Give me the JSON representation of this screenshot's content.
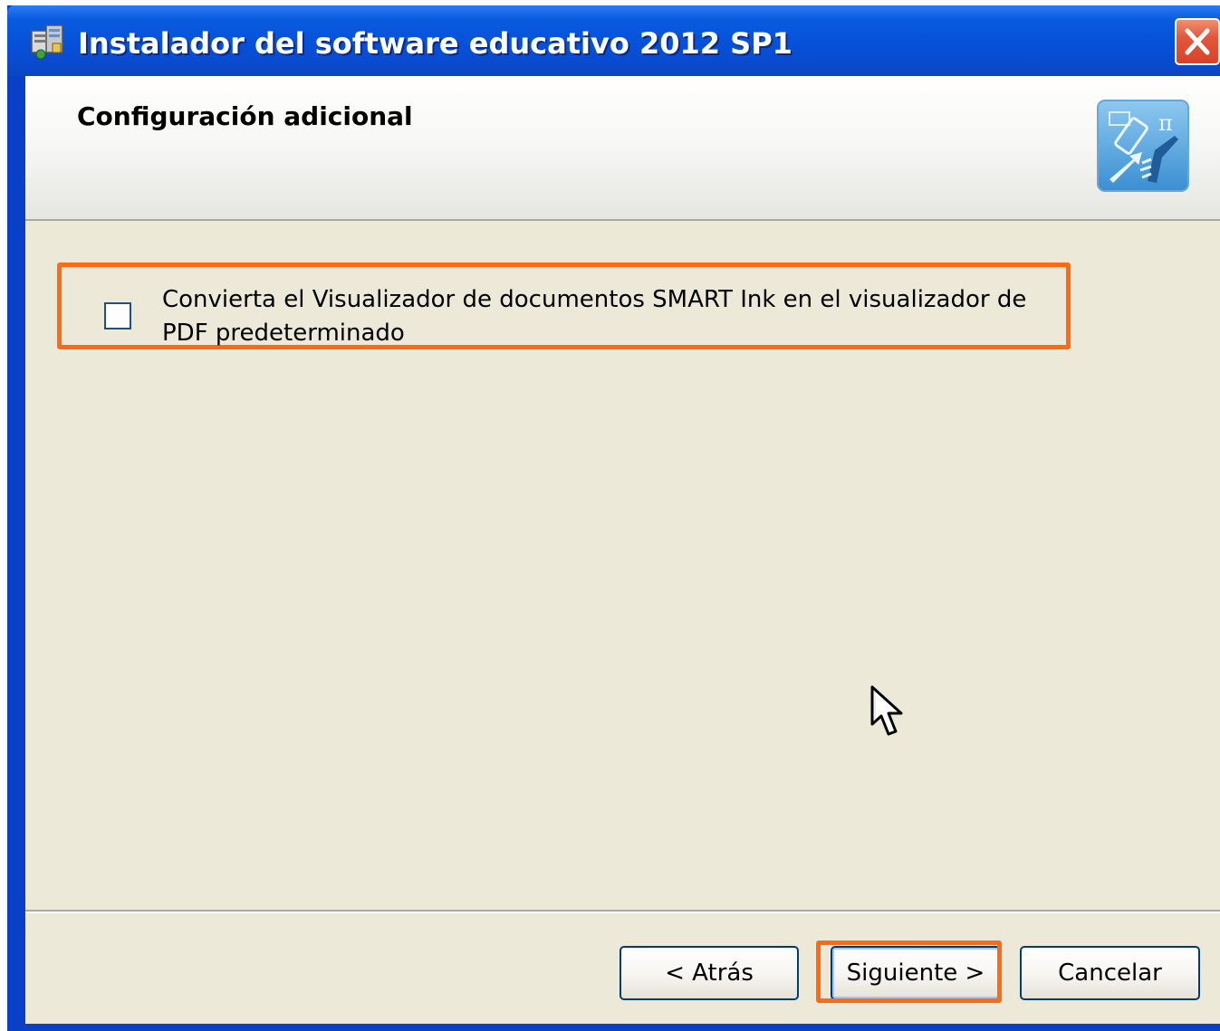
{
  "window": {
    "title": "Instalador del software educativo 2012 SP1",
    "close_icon": "close-icon",
    "app_icon": "installer-icon"
  },
  "header": {
    "title": "Configuración adicional",
    "logo_icon": "smart-education-icon"
  },
  "options": [
    {
      "label": "Convierta el Visualizador de documentos SMART Ink en el visualizador de PDF predeterminado",
      "checked": false,
      "highlighted": true
    }
  ],
  "footer": {
    "back_label": "< Atrás",
    "next_label": "Siguiente >",
    "cancel_label": "Cancelar"
  },
  "colors": {
    "titlebar": "#0651d8",
    "dialog_background": "#ece9d8",
    "highlight": "#ff6a13",
    "close_button": "#d8432a"
  }
}
